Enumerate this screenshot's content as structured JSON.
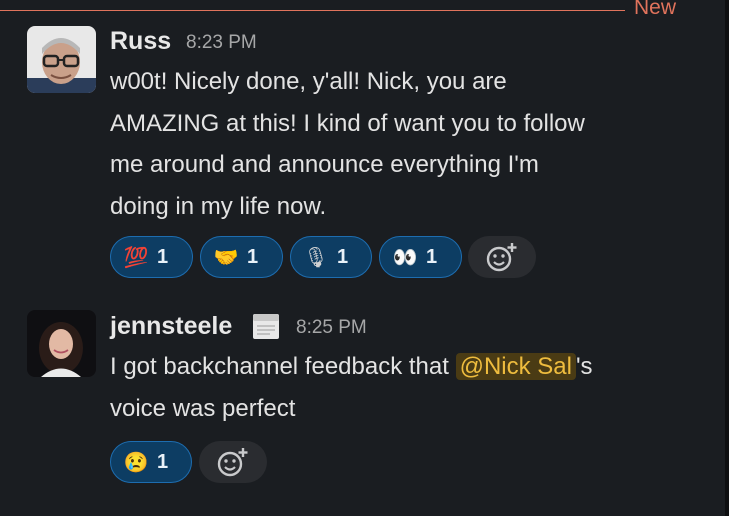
{
  "divider": {
    "label": "New",
    "color": "#e0735c"
  },
  "messages": [
    {
      "author": "Russ",
      "time": "8:23 PM",
      "lines": [
        "w00t! Nicely done, y'all! Nick, you are",
        "AMAZING at this! I kind of want you to follow",
        "me around and announce everything I'm",
        "doing in my life now."
      ],
      "reactions": [
        {
          "emoji": "💯",
          "icon": "hundred-points-icon",
          "count": "1"
        },
        {
          "emoji": "🤝",
          "icon": "handshake-icon",
          "count": "1"
        },
        {
          "emoji": "🎙",
          "icon": "microphone-icon",
          "count": "1"
        },
        {
          "emoji": "👀",
          "icon": "eyes-icon",
          "count": "1"
        }
      ]
    },
    {
      "author": "jennsteele",
      "status_icon": "calendar-icon",
      "time": "8:25 PM",
      "text_before": "I got backchannel feedback that ",
      "mention": "@Nick Sal",
      "text_after": "'s",
      "line2": "voice was perfect",
      "reactions": [
        {
          "emoji": "😢",
          "icon": "crying-face-icon",
          "count": "1"
        }
      ]
    }
  ],
  "colors": {
    "background": "#1a1d21",
    "reaction_bg": "#0d3d63",
    "reaction_border": "#1d6db0",
    "mention": "#eebc3e"
  }
}
